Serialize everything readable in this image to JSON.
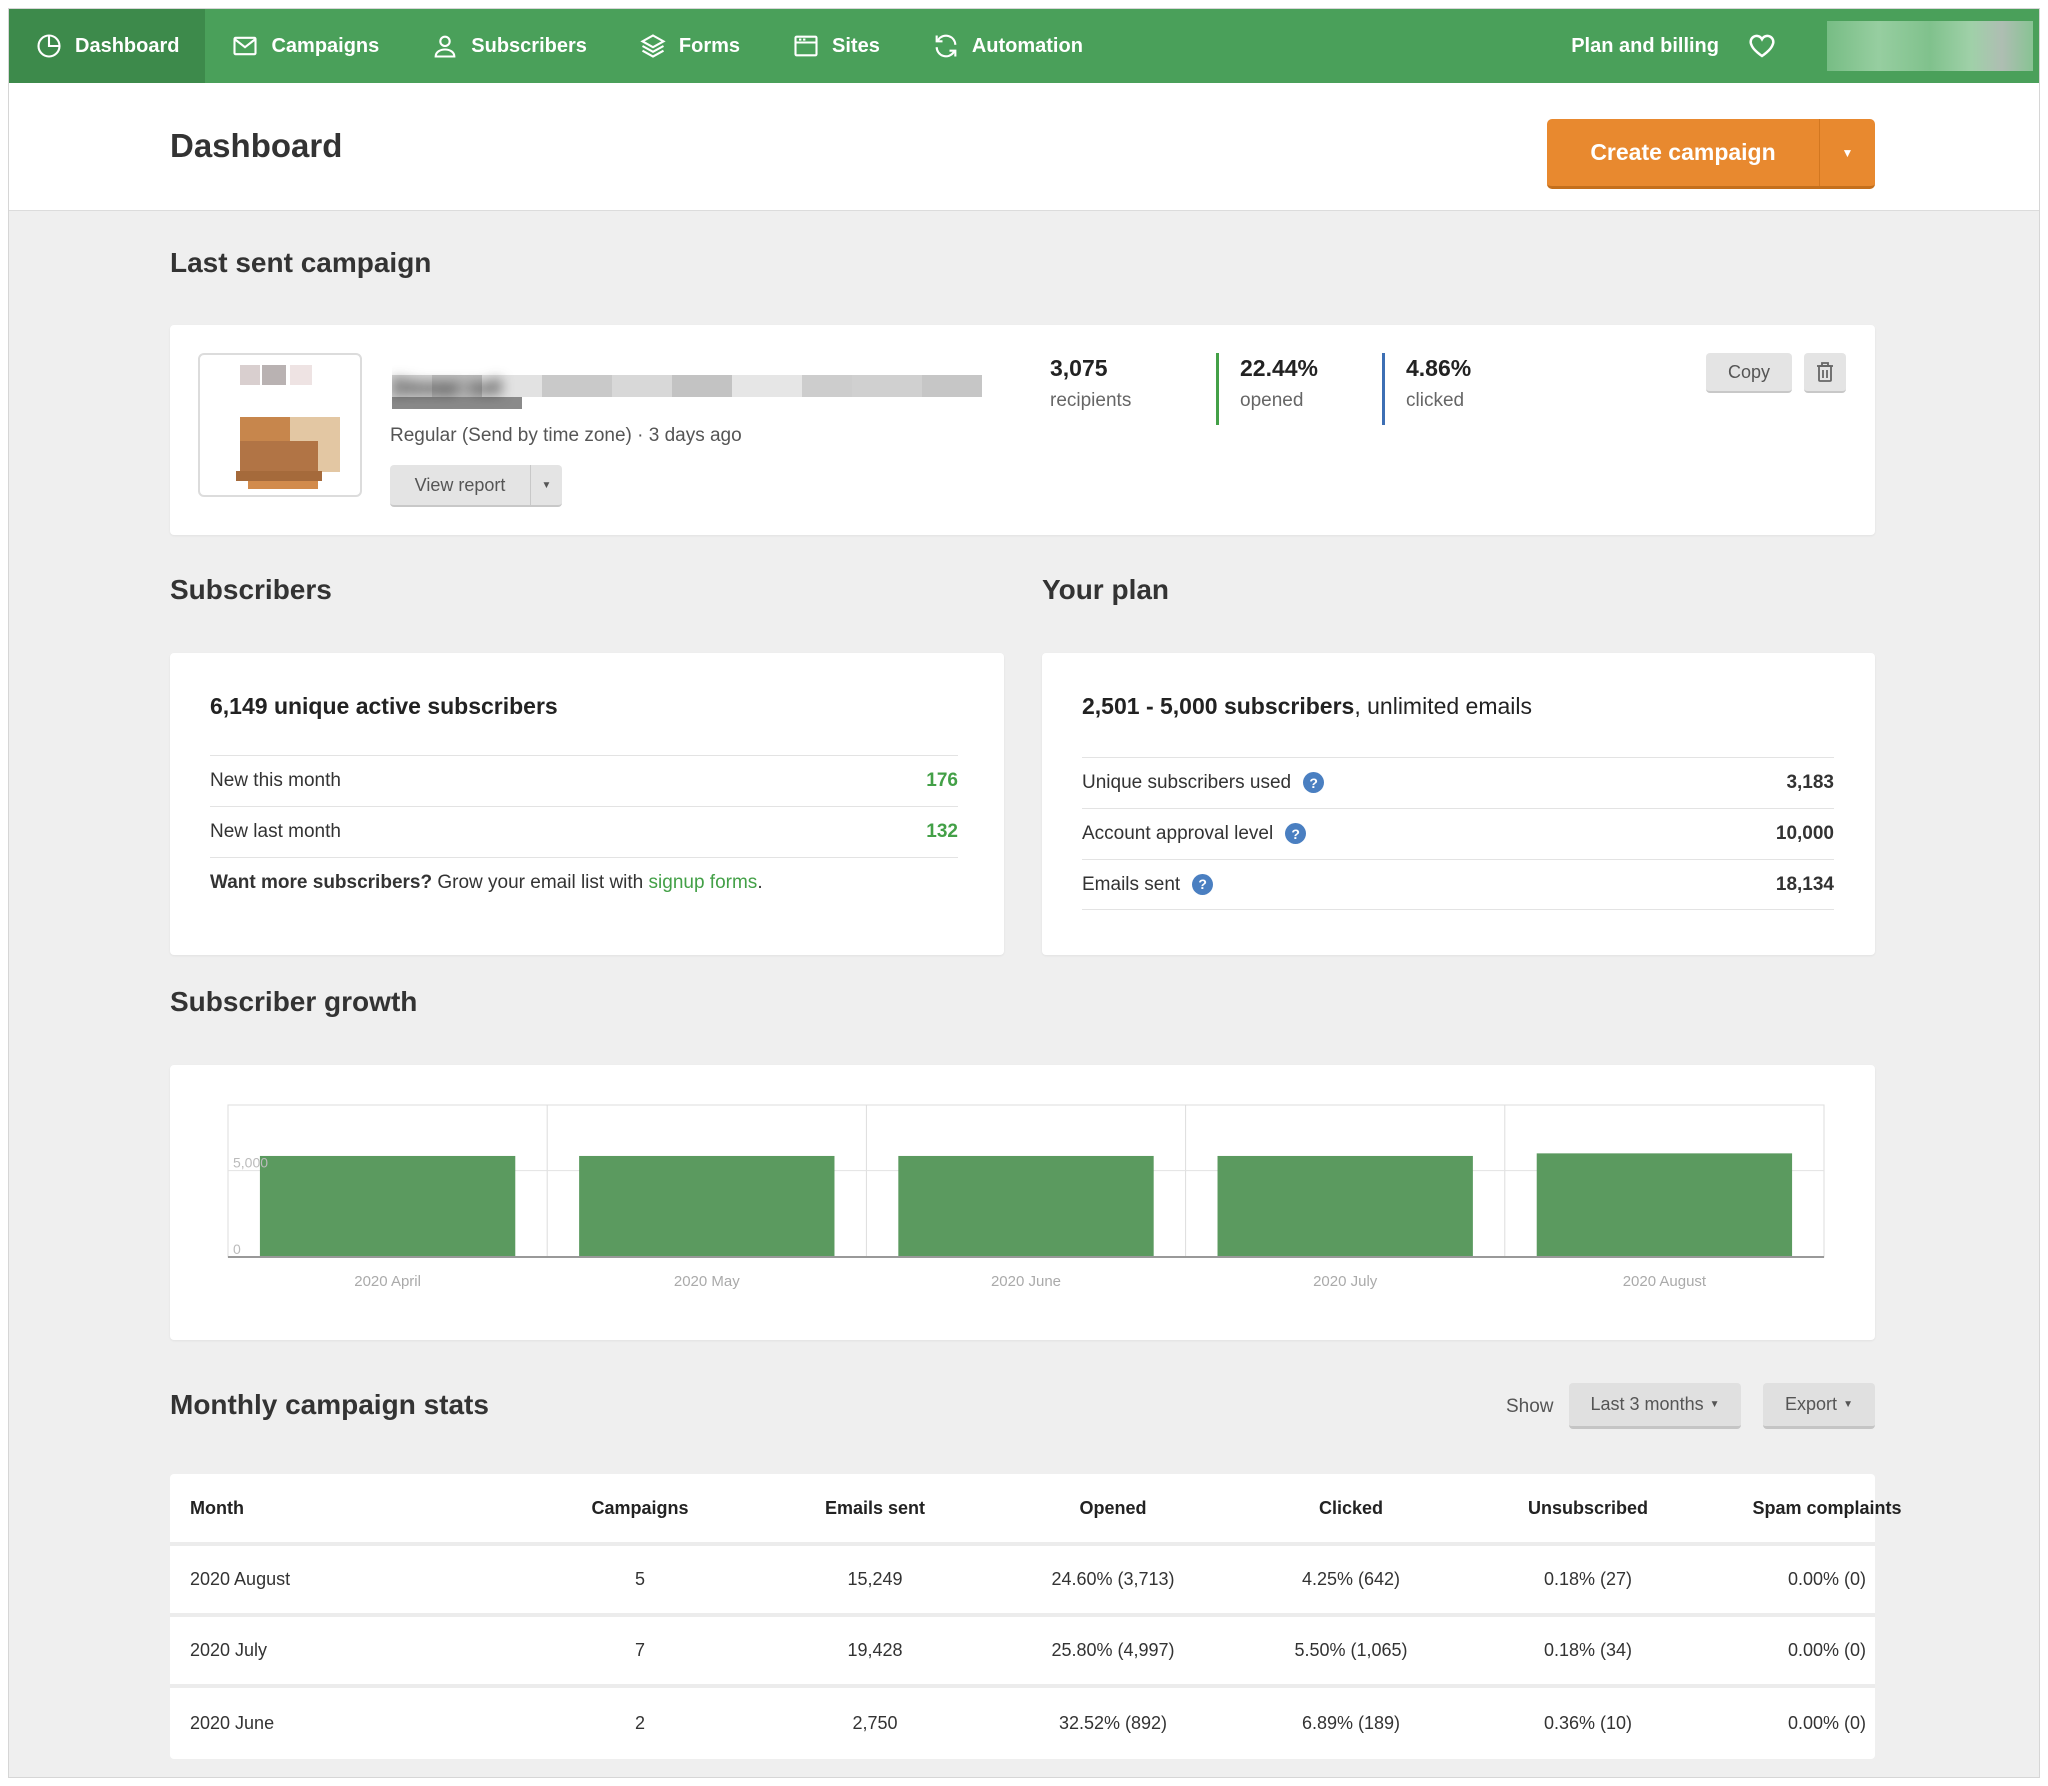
{
  "nav": {
    "items": [
      {
        "label": "Dashboard"
      },
      {
        "label": "Campaigns"
      },
      {
        "label": "Subscribers"
      },
      {
        "label": "Forms"
      },
      {
        "label": "Sites"
      },
      {
        "label": "Automation"
      }
    ],
    "plan_billing": "Plan and billing"
  },
  "header": {
    "title": "Dashboard",
    "create_campaign": "Create campaign"
  },
  "last_campaign": {
    "section_title": "Last sent campaign",
    "name": "Dinner roll",
    "meta": "Regular (Send by time zone) · 3 days ago",
    "view_report": "View report",
    "recipients_value": "3,075",
    "recipients_label": "recipients",
    "opened_value": "22.44%",
    "opened_label": "opened",
    "clicked_value": "4.86%",
    "clicked_label": "clicked",
    "copy": "Copy",
    "opened_color": "#43a047",
    "clicked_color": "#3d6fb4"
  },
  "subscribers": {
    "section_title": "Subscribers",
    "heading": "6,149 unique active subscribers",
    "rows": [
      {
        "label": "New this month",
        "value": "176"
      },
      {
        "label": "New last month",
        "value": "132"
      }
    ],
    "cta_bold": "Want more subscribers?",
    "cta_text": " Grow your email list with ",
    "cta_link": "signup forms",
    "cta_end": "."
  },
  "plan": {
    "section_title": "Your plan",
    "heading_bold": "2,501 - 5,000 subscribers",
    "heading_rest": ", unlimited emails",
    "rows": [
      {
        "label": "Unique subscribers used",
        "value": "3,183"
      },
      {
        "label": "Account approval level",
        "value": "10,000"
      },
      {
        "label": "Emails sent",
        "value": "18,134"
      }
    ],
    "help_glyph": "?"
  },
  "growth": {
    "section_title": "Subscriber growth"
  },
  "chart_data": {
    "type": "bar",
    "categories": [
      "2020 April",
      "2020 May",
      "2020 June",
      "2020 July",
      "2020 August"
    ],
    "values": [
      5850,
      5850,
      5850,
      5850,
      6000
    ],
    "yticks": [
      0,
      5000
    ],
    "ytick_labels": [
      "0",
      "5,000"
    ],
    "ylim": [
      0,
      8800
    ],
    "grid": true,
    "bar_color": "#5b9a5f"
  },
  "monthly": {
    "section_title": "Monthly campaign stats",
    "show_label": "Show",
    "range": "Last 3 months",
    "export": "Export",
    "columns": [
      "Month",
      "Campaigns",
      "Emails sent",
      "Opened",
      "Clicked",
      "Unsubscribed",
      "Spam complaints"
    ],
    "rows": [
      [
        "2020 August",
        "5",
        "15,249",
        "24.60% (3,713)",
        "4.25% (642)",
        "0.18% (27)",
        "0.00% (0)"
      ],
      [
        "2020 July",
        "7",
        "19,428",
        "25.80% (4,997)",
        "5.50% (1,065)",
        "0.18% (34)",
        "0.00% (0)"
      ],
      [
        "2020 June",
        "2",
        "2,750",
        "32.52% (892)",
        "6.89% (189)",
        "0.36% (10)",
        "0.00% (0)"
      ]
    ]
  }
}
